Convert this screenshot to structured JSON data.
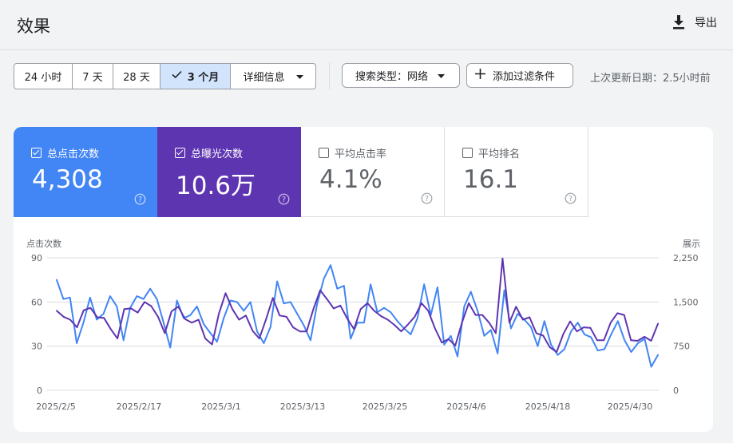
{
  "header": {
    "title": "效果",
    "export_label": "导出"
  },
  "toolbar": {
    "ranges": [
      "24 小时",
      "7 天",
      "28 天",
      "3 个月"
    ],
    "active_range": "3 个月",
    "details_label": "详细信息",
    "search_type_label": "搜索类型：网络",
    "add_filter_label": "添加过滤条件",
    "last_update": "上次更新日期：2.5小时前"
  },
  "metrics": [
    {
      "label": "总点击次数",
      "value": "4,308",
      "checked": true,
      "color": "#4285f4"
    },
    {
      "label": "总曝光次数",
      "value": "10.6万",
      "checked": true,
      "color": "#5e35b1"
    },
    {
      "label": "平均点击率",
      "value": "4.1%",
      "checked": false
    },
    {
      "label": "平均排名",
      "value": "16.1",
      "checked": false
    }
  ],
  "chart_data": {
    "type": "line",
    "left_axis_label": "点击次数",
    "right_axis_label": "展示",
    "left_ticks": [
      "90",
      "60",
      "30",
      "0"
    ],
    "right_ticks": [
      "2,250",
      "1,500",
      "750",
      "0"
    ],
    "ylim_left": [
      0,
      90
    ],
    "ylim_right": [
      0,
      2250
    ],
    "x_labels": [
      "2025/2/5",
      "2025/2/17",
      "2025/3/1",
      "2025/3/13",
      "2025/3/25",
      "2025/4/6",
      "2025/4/18",
      "2025/4/30"
    ],
    "series": [
      {
        "name": "点击次数",
        "axis": "left",
        "color": "#4285f4",
        "values": [
          75,
          62,
          63,
          32,
          46,
          63,
          48,
          52,
          64,
          57,
          34,
          56,
          64,
          62,
          69,
          62,
          46,
          29,
          61,
          49,
          51,
          57,
          45,
          39,
          33,
          49,
          61,
          60,
          54,
          60,
          40,
          32,
          43,
          74,
          59,
          60,
          52,
          44,
          34,
          59,
          76,
          85,
          69,
          71,
          35,
          46,
          46,
          72,
          53,
          56,
          53,
          47,
          42,
          38,
          49,
          72,
          51,
          70,
          31,
          37,
          23,
          57,
          67,
          54,
          37,
          41,
          25,
          68,
          42,
          52,
          48,
          43,
          30,
          47,
          31,
          24,
          28,
          40,
          46,
          38,
          36,
          27,
          28,
          38,
          47,
          34,
          26,
          32,
          35,
          16,
          24
        ]
      },
      {
        "name": "展示",
        "axis": "right",
        "color": "#5e35b1",
        "values": [
          1350,
          1250,
          1200,
          1070,
          1360,
          1400,
          1240,
          1230,
          1040,
          880,
          1380,
          1390,
          1320,
          1500,
          1430,
          1250,
          970,
          1340,
          1420,
          1210,
          1150,
          1200,
          880,
          780,
          1300,
          1650,
          1380,
          1200,
          1270,
          1010,
          880,
          1210,
          1570,
          1270,
          1250,
          1070,
          1000,
          1000,
          1380,
          1700,
          1550,
          1390,
          1440,
          1220,
          1040,
          1380,
          1480,
          1350,
          1260,
          1200,
          1110,
          1000,
          1120,
          1250,
          1480,
          1350,
          1050,
          810,
          870,
          760,
          1150,
          1480,
          1280,
          1280,
          1150,
          970,
          2240,
          1150,
          1420,
          1200,
          1240,
          970,
          930,
          730,
          650,
          960,
          1170,
          1000,
          1070,
          1060,
          850,
          850,
          1150,
          1310,
          1280,
          850,
          840,
          910,
          840,
          1130
        ]
      }
    ],
    "grid": true,
    "legend": "none"
  }
}
